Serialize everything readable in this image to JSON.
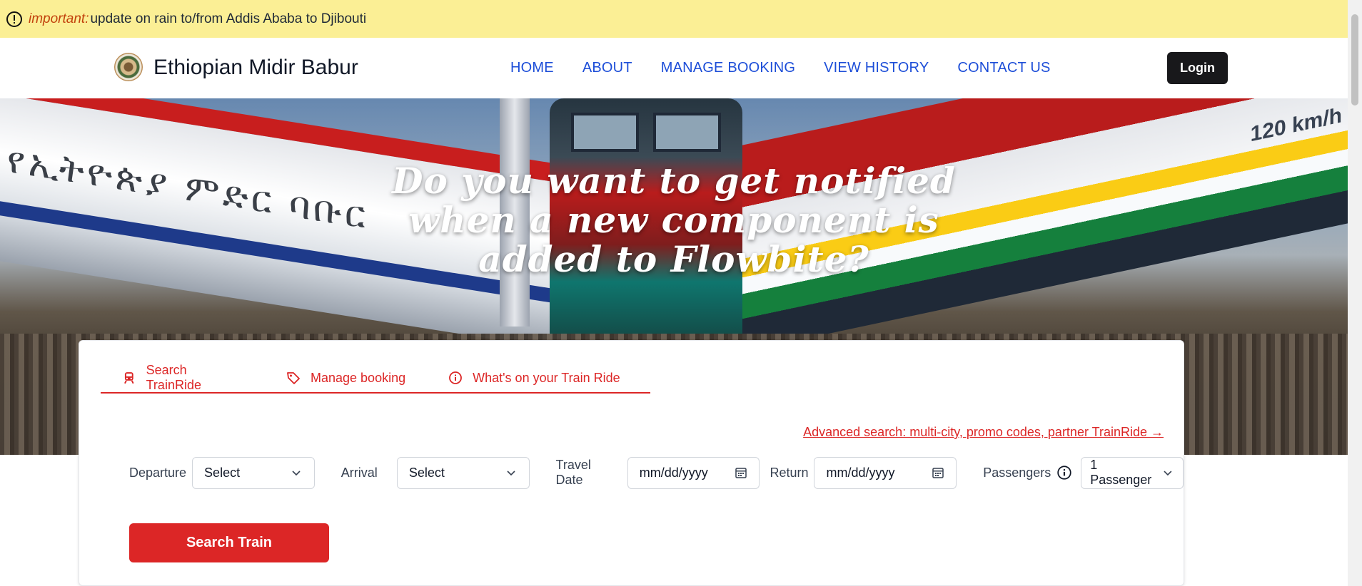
{
  "announcement": {
    "label": "important:",
    "text": "update on rain to/from Addis Ababa to Djibouti"
  },
  "nav": {
    "brand": "Ethiopian Midir Babur",
    "links": [
      "HOME",
      "ABOUT",
      "MANAGE BOOKING",
      "VIEW HISTORY",
      "CONTACT US"
    ],
    "login": "Login"
  },
  "hero": {
    "title_lines": [
      "Do you want to get notified",
      "when a new component is",
      "added to Flowbite?"
    ],
    "train_script": "የኢትዮጵያ ምድር ባቡር",
    "speed_sign": "120 km/h"
  },
  "search": {
    "tabs": [
      {
        "label": "Search TrainRide",
        "icon": "train-icon"
      },
      {
        "label": "Manage booking",
        "icon": "tag-icon"
      },
      {
        "label": "What's on your Train Ride",
        "icon": "info-icon"
      }
    ],
    "advanced_link": "Advanced search: multi-city, promo codes, partner TrainRide →",
    "departure_label": "Departure",
    "departure_value": "Select",
    "arrival_label": "Arrival",
    "arrival_value": "Select",
    "travel_date_label": "Travel Date",
    "travel_date_value": "mm/dd/yyyy",
    "return_label": "Return",
    "return_value": "mm/dd/yyyy",
    "passengers_label": "Passengers",
    "passengers_value": "1 Passenger",
    "search_button": "Search Train"
  },
  "colors": {
    "accent": "#dc2626",
    "nav_link": "#1d4ed8",
    "announce_bg": "#fbef95"
  }
}
